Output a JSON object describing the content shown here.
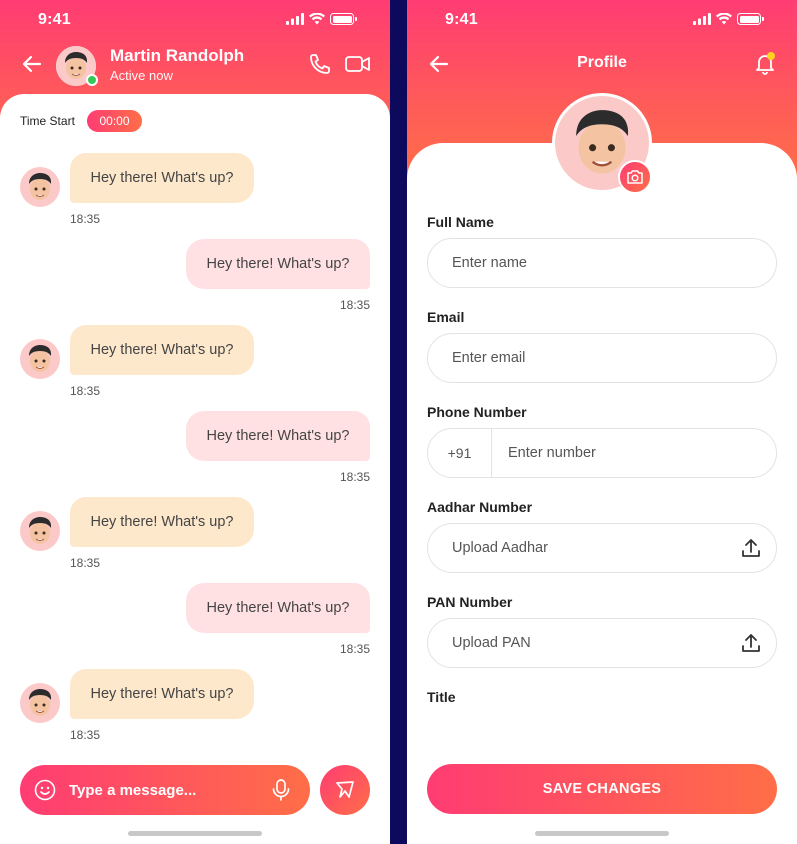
{
  "colors": {
    "accent_start": "#ff3c73",
    "accent_end": "#ff6e47",
    "online": "#35c759",
    "incoming_bubble": "#fde8cc",
    "outgoing_bubble": "#ffe1e3",
    "notification_dot": "#ffd21f",
    "divider_background": "#0d0a5e"
  },
  "status_bar": {
    "time": "9:41",
    "icons": [
      "signal-icon",
      "wifi-icon",
      "battery-icon"
    ]
  },
  "chat": {
    "contact": {
      "name": "Martin Randolph",
      "status": "Active now"
    },
    "timer": {
      "label": "Time Start",
      "value": "00:00"
    },
    "messages": [
      {
        "direction": "in",
        "text": "Hey there! What's up?",
        "time": "18:35"
      },
      {
        "direction": "out",
        "text": "Hey there! What's up?",
        "time": "18:35"
      },
      {
        "direction": "in",
        "text": "Hey there! What's up?",
        "time": "18:35"
      },
      {
        "direction": "out",
        "text": "Hey there! What's up?",
        "time": "18:35"
      },
      {
        "direction": "in",
        "text": "Hey there! What's up?",
        "time": "18:35"
      },
      {
        "direction": "out",
        "text": "Hey there! What's up?",
        "time": "18:35"
      },
      {
        "direction": "in",
        "text": "Hey there! What's up?",
        "time": "18:35"
      }
    ],
    "composer": {
      "placeholder": "Type a message..."
    }
  },
  "profile": {
    "title": "Profile",
    "fields": {
      "full_name": {
        "label": "Full Name",
        "placeholder": "Enter name"
      },
      "email": {
        "label": "Email",
        "placeholder": "Enter email"
      },
      "phone": {
        "label": "Phone Number",
        "country_code": "+91",
        "placeholder": "Enter number"
      },
      "aadhar": {
        "label": "Aadhar Number",
        "placeholder": "Upload Aadhar"
      },
      "pan": {
        "label": "PAN Number",
        "placeholder": "Upload PAN"
      },
      "title": {
        "label": "Title"
      }
    },
    "save_label": "SAVE CHANGES"
  }
}
